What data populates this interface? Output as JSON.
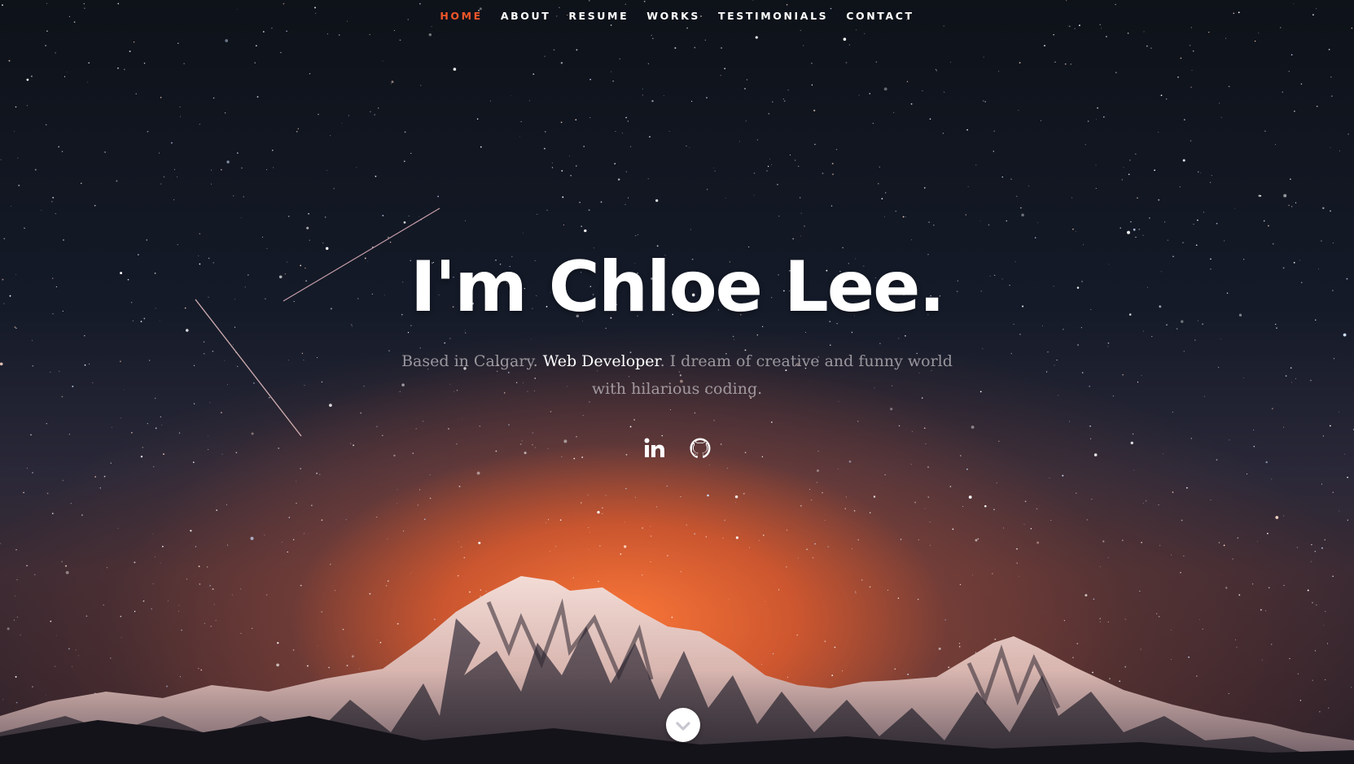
{
  "nav": {
    "items": [
      {
        "label": "HOME",
        "active": true
      },
      {
        "label": "ABOUT",
        "active": false
      },
      {
        "label": "RESUME",
        "active": false
      },
      {
        "label": "WORKS",
        "active": false
      },
      {
        "label": "TESTIMONIALS",
        "active": false
      },
      {
        "label": "CONTACT",
        "active": false
      }
    ],
    "active_color": "#f0562a"
  },
  "banner": {
    "headline": "I'm Chloe Lee.",
    "intro_before": "Based in Calgary. ",
    "role": "Web Developer",
    "intro_after": ". I dream of creative and funny world with hilarious coding."
  },
  "social": [
    {
      "icon": "linkedin-icon"
    },
    {
      "icon": "github-icon"
    }
  ],
  "scroll_down": {
    "icon": "chevron-down-icon"
  },
  "colors": {
    "accent": "#f0562a",
    "text": "#ffffff"
  }
}
